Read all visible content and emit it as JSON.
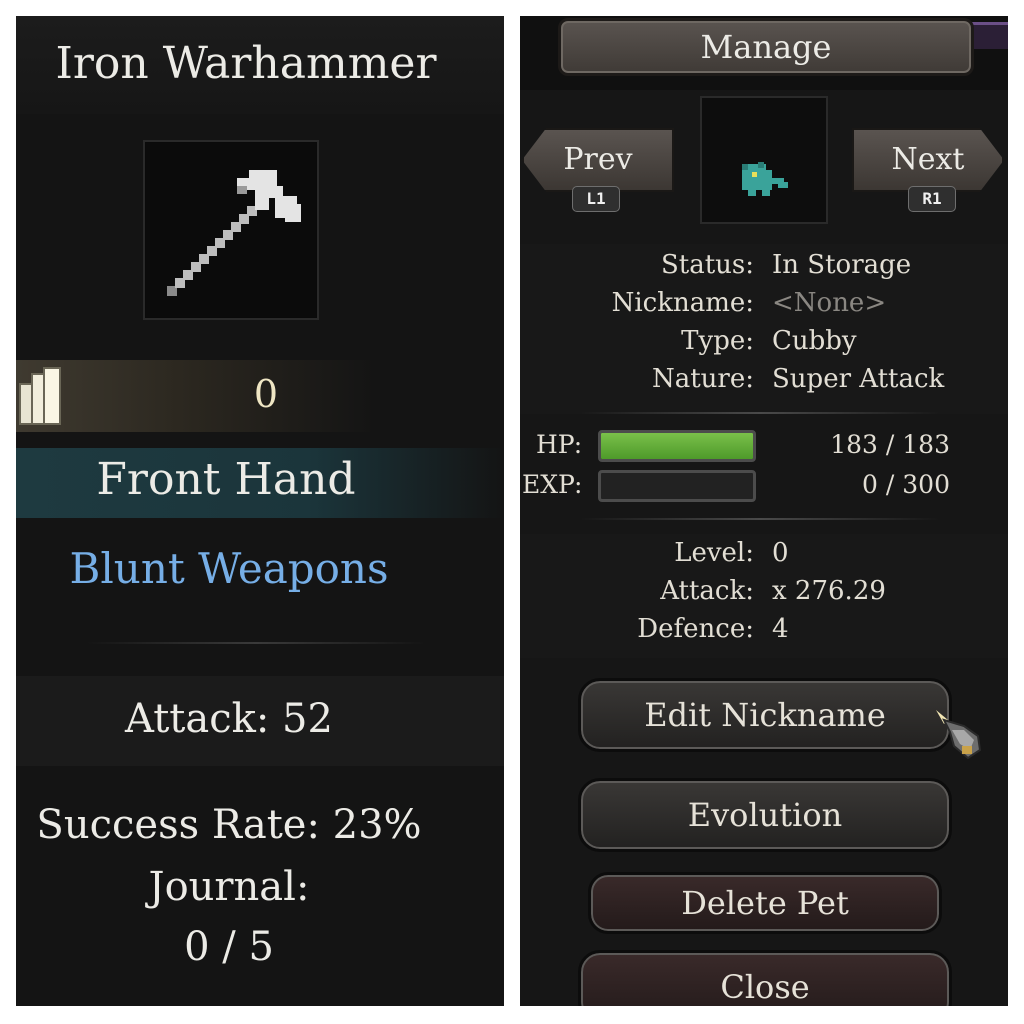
{
  "left": {
    "item_name": "Iron Warhammer",
    "item_icon": "warhammer-icon",
    "count": "0",
    "slot": "Front Hand",
    "weapon_type": "Blunt Weapons",
    "attack_text": "Attack: 52",
    "success_rate_text": "Success Rate: 23%",
    "journal_label": "Journal:",
    "journal_value": "0 / 5",
    "colors": {
      "weapon_type": "#76aee6",
      "slot_band": "#1e3a40"
    }
  },
  "right": {
    "header": "Manage",
    "prev": {
      "label": "Prev",
      "key": "L1"
    },
    "next": {
      "label": "Next",
      "key": "R1"
    },
    "pet_icon": "cubby-pet-icon",
    "info": [
      {
        "label": "Status:",
        "value": "In Storage"
      },
      {
        "label": "Nickname:",
        "value": "<None>"
      },
      {
        "label": "Type:",
        "value": "Cubby"
      },
      {
        "label": "Nature:",
        "value": "Super Attack"
      }
    ],
    "hp": {
      "label": "HP:",
      "value": "183 / 183",
      "fraction": 1.0
    },
    "exp": {
      "label": "EXP:",
      "value": "0 / 300",
      "fraction": 0.0
    },
    "stats": [
      {
        "label": "Level:",
        "value": "0"
      },
      {
        "label": "Attack:",
        "value": "x 276.29"
      },
      {
        "label": "Defence:",
        "value": "4"
      }
    ],
    "buttons": {
      "edit_nickname": "Edit Nickname",
      "evolution": "Evolution",
      "delete_pet": "Delete Pet",
      "close": "Close"
    },
    "colors": {
      "hp_fill": "#5fae35",
      "accent_purple": "#6b4f87"
    }
  }
}
